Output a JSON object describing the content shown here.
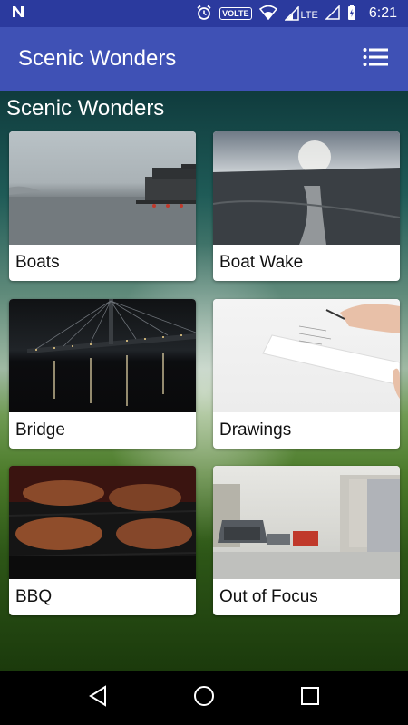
{
  "status_bar": {
    "time": "6:21",
    "volte": "VOLTE",
    "network": "LTE"
  },
  "app_bar": {
    "title": "Scenic Wonders"
  },
  "section": {
    "title": "Scenic Wonders"
  },
  "cards": [
    {
      "label": "Boats"
    },
    {
      "label": "Boat Wake"
    },
    {
      "label": "Bridge"
    },
    {
      "label": "Drawings"
    },
    {
      "label": "BBQ"
    },
    {
      "label": "Out of Focus"
    }
  ],
  "colors": {
    "status_bar": "#2b3a9e",
    "app_bar": "#3f51b5",
    "card": "#ffffff"
  },
  "icons": {
    "notification": "n-icon",
    "alarm": "alarm-icon",
    "wifi": "wifi-icon",
    "signal": "signal-icon",
    "battery": "battery-charging-icon",
    "menu": "list-menu-icon",
    "back": "back-icon",
    "home": "home-icon",
    "recents": "recents-icon"
  }
}
